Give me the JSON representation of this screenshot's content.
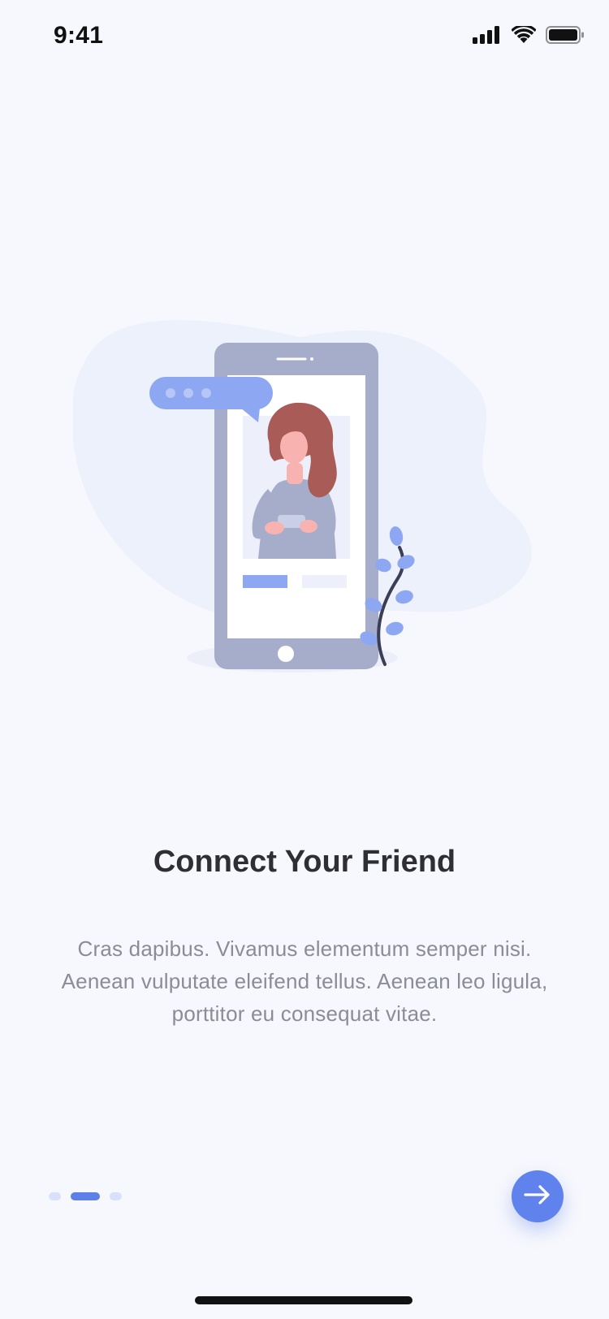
{
  "status_bar": {
    "time": "9:41",
    "icons": [
      "cellular-signal-icon",
      "wifi-icon",
      "battery-icon"
    ]
  },
  "illustration": {
    "name": "woman-holding-phone-illustration",
    "colors": {
      "blob": "#EDF1FB",
      "phone": "#A5ADCB",
      "screen": "#FFFFFF",
      "accent": "#8EA7F2",
      "hair": "#A95B57",
      "skin": "#F8B3B0",
      "stem": "#3B3E54"
    }
  },
  "onboarding": {
    "title": "Connect Your Friend",
    "description": "Cras dapibus. Vivamus elementum semper nisi. Aenean vulputate eleifend tellus. Aenean leo ligula, porttitor eu consequat vitae."
  },
  "pager": {
    "total": 3,
    "active_index": 1
  },
  "next_button": {
    "icon": "arrow-right-icon",
    "color": "#5F82EC"
  },
  "colors": {
    "background": "#F7F8FD",
    "title": "#2E2E33",
    "body": "#8B8D96",
    "pager_active": "#5D7FE8",
    "pager_inactive": "#D9E1FA"
  }
}
